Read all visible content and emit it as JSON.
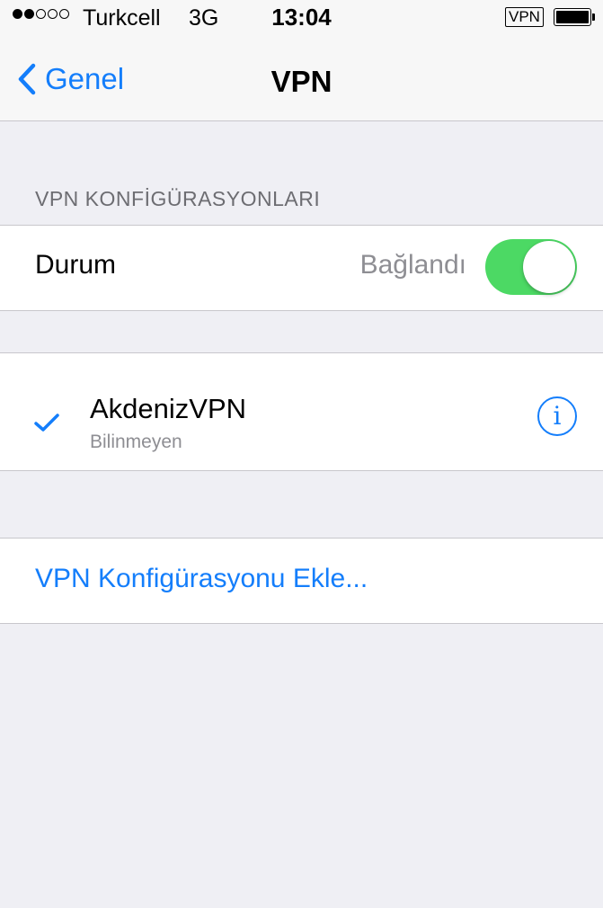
{
  "status_bar": {
    "signal_filled": 2,
    "signal_total": 5,
    "carrier": "Turkcell",
    "network": "3G",
    "time": "13:04",
    "vpn_badge": "VPN",
    "battery_level": 1.0
  },
  "nav": {
    "back_label": "Genel",
    "back_icon": "chevron-left-icon",
    "title": "VPN"
  },
  "section_header": "VPN KONFİGÜRASYONLARI",
  "status_row": {
    "label": "Durum",
    "value": "Bağlandı",
    "toggle_on": true
  },
  "vpn_config": {
    "name": "AkdenizVPN",
    "detail": "Bilinmeyen",
    "selected": true,
    "info_glyph": "i",
    "info_icon": "info-circle-icon"
  },
  "add_config_label": "VPN Konfigürasyonu Ekle...",
  "colors": {
    "accent": "#147efb",
    "toggle_on": "#4cd964",
    "background": "#efeff4",
    "secondary_text": "#8e8e93"
  }
}
